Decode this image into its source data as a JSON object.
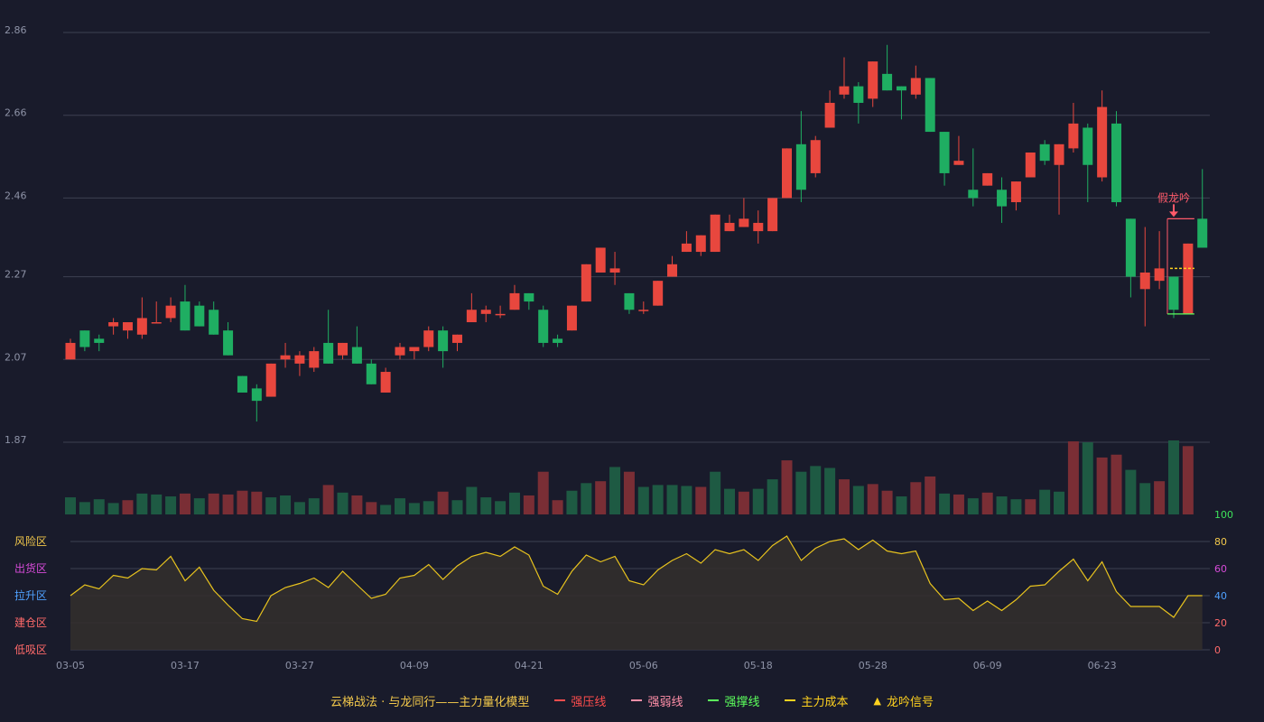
{
  "chart_data": {
    "type": "candlestick",
    "x_ticks": [
      "03-05",
      "03-17",
      "03-27",
      "04-09",
      "04-21",
      "05-06",
      "05-18",
      "05-28",
      "06-09",
      "06-23"
    ],
    "price_axis": {
      "ticks": [
        "2.86",
        "2.66",
        "2.46",
        "2.27",
        "2.07",
        "1.87"
      ],
      "ylim": [
        1.87,
        2.86
      ]
    },
    "candles": [
      {
        "o": 2.07,
        "c": 2.11,
        "h": 2.12,
        "l": 2.07
      },
      {
        "o": 2.14,
        "c": 2.1,
        "h": 2.14,
        "l": 2.09
      },
      {
        "o": 2.12,
        "c": 2.11,
        "h": 2.13,
        "l": 2.09
      },
      {
        "o": 2.15,
        "c": 2.16,
        "h": 2.17,
        "l": 2.13
      },
      {
        "o": 2.14,
        "c": 2.16,
        "h": 2.16,
        "l": 2.12
      },
      {
        "o": 2.13,
        "c": 2.17,
        "h": 2.22,
        "l": 2.12
      },
      {
        "o": 2.16,
        "c": 2.16,
        "h": 2.21,
        "l": 2.16
      },
      {
        "o": 2.17,
        "c": 2.2,
        "h": 2.22,
        "l": 2.16
      },
      {
        "o": 2.21,
        "c": 2.14,
        "h": 2.25,
        "l": 2.14
      },
      {
        "o": 2.2,
        "c": 2.15,
        "h": 2.21,
        "l": 2.15
      },
      {
        "o": 2.19,
        "c": 2.13,
        "h": 2.21,
        "l": 2.13
      },
      {
        "o": 2.14,
        "c": 2.08,
        "h": 2.16,
        "l": 2.08
      },
      {
        "o": 2.03,
        "c": 1.99,
        "h": 2.03,
        "l": 1.99
      },
      {
        "o": 2.0,
        "c": 1.97,
        "h": 2.01,
        "l": 1.92
      },
      {
        "o": 1.98,
        "c": 2.06,
        "h": 2.06,
        "l": 1.98
      },
      {
        "o": 2.07,
        "c": 2.08,
        "h": 2.11,
        "l": 2.05
      },
      {
        "o": 2.06,
        "c": 2.08,
        "h": 2.09,
        "l": 2.03
      },
      {
        "o": 2.05,
        "c": 2.09,
        "h": 2.1,
        "l": 2.04
      },
      {
        "o": 2.11,
        "c": 2.06,
        "h": 2.19,
        "l": 2.06
      },
      {
        "o": 2.08,
        "c": 2.11,
        "h": 2.11,
        "l": 2.07
      },
      {
        "o": 2.1,
        "c": 2.06,
        "h": 2.15,
        "l": 2.06
      },
      {
        "o": 2.06,
        "c": 2.01,
        "h": 2.07,
        "l": 2.01
      },
      {
        "o": 1.99,
        "c": 2.04,
        "h": 2.05,
        "l": 1.99
      },
      {
        "o": 2.08,
        "c": 2.1,
        "h": 2.11,
        "l": 2.07
      },
      {
        "o": 2.09,
        "c": 2.1,
        "h": 2.1,
        "l": 2.07
      },
      {
        "o": 2.1,
        "c": 2.14,
        "h": 2.15,
        "l": 2.09
      },
      {
        "o": 2.14,
        "c": 2.09,
        "h": 2.15,
        "l": 2.05
      },
      {
        "o": 2.11,
        "c": 2.13,
        "h": 2.13,
        "l": 2.09
      },
      {
        "o": 2.16,
        "c": 2.19,
        "h": 2.23,
        "l": 2.16
      },
      {
        "o": 2.18,
        "c": 2.19,
        "h": 2.2,
        "l": 2.16
      },
      {
        "o": 2.18,
        "c": 2.18,
        "h": 2.2,
        "l": 2.17
      },
      {
        "o": 2.19,
        "c": 2.23,
        "h": 2.25,
        "l": 2.19
      },
      {
        "o": 2.23,
        "c": 2.21,
        "h": 2.23,
        "l": 2.19
      },
      {
        "o": 2.19,
        "c": 2.11,
        "h": 2.2,
        "l": 2.1
      },
      {
        "o": 2.12,
        "c": 2.11,
        "h": 2.13,
        "l": 2.1
      },
      {
        "o": 2.14,
        "c": 2.2,
        "h": 2.2,
        "l": 2.14
      },
      {
        "o": 2.21,
        "c": 2.3,
        "h": 2.3,
        "l": 2.21
      },
      {
        "o": 2.28,
        "c": 2.34,
        "h": 2.34,
        "l": 2.28
      },
      {
        "o": 2.28,
        "c": 2.29,
        "h": 2.33,
        "l": 2.25
      },
      {
        "o": 2.23,
        "c": 2.19,
        "h": 2.23,
        "l": 2.18
      },
      {
        "o": 2.19,
        "c": 2.19,
        "h": 2.21,
        "l": 2.18
      },
      {
        "o": 2.2,
        "c": 2.26,
        "h": 2.26,
        "l": 2.2
      },
      {
        "o": 2.27,
        "c": 2.3,
        "h": 2.32,
        "l": 2.27
      },
      {
        "o": 2.33,
        "c": 2.35,
        "h": 2.38,
        "l": 2.33
      },
      {
        "o": 2.33,
        "c": 2.37,
        "h": 2.37,
        "l": 2.32
      },
      {
        "o": 2.33,
        "c": 2.42,
        "h": 2.42,
        "l": 2.33
      },
      {
        "o": 2.38,
        "c": 2.4,
        "h": 2.42,
        "l": 2.38
      },
      {
        "o": 2.39,
        "c": 2.41,
        "h": 2.46,
        "l": 2.39
      },
      {
        "o": 2.38,
        "c": 2.4,
        "h": 2.43,
        "l": 2.35
      },
      {
        "o": 2.38,
        "c": 2.46,
        "h": 2.46,
        "l": 2.38
      },
      {
        "o": 2.46,
        "c": 2.58,
        "h": 2.58,
        "l": 2.46
      },
      {
        "o": 2.59,
        "c": 2.48,
        "h": 2.67,
        "l": 2.45
      },
      {
        "o": 2.52,
        "c": 2.6,
        "h": 2.61,
        "l": 2.51
      },
      {
        "o": 2.63,
        "c": 2.69,
        "h": 2.72,
        "l": 2.63
      },
      {
        "o": 2.71,
        "c": 2.73,
        "h": 2.8,
        "l": 2.7
      },
      {
        "o": 2.73,
        "c": 2.69,
        "h": 2.74,
        "l": 2.64
      },
      {
        "o": 2.7,
        "c": 2.79,
        "h": 2.79,
        "l": 2.68
      },
      {
        "o": 2.76,
        "c": 2.72,
        "h": 2.83,
        "l": 2.72
      },
      {
        "o": 2.73,
        "c": 2.72,
        "h": 2.73,
        "l": 2.65
      },
      {
        "o": 2.71,
        "c": 2.75,
        "h": 2.78,
        "l": 2.7
      },
      {
        "o": 2.75,
        "c": 2.62,
        "h": 2.75,
        "l": 2.62
      },
      {
        "o": 2.62,
        "c": 2.52,
        "h": 2.62,
        "l": 2.49
      },
      {
        "o": 2.54,
        "c": 2.55,
        "h": 2.61,
        "l": 2.54
      },
      {
        "o": 2.48,
        "c": 2.46,
        "h": 2.58,
        "l": 2.44
      },
      {
        "o": 2.49,
        "c": 2.52,
        "h": 2.52,
        "l": 2.49
      },
      {
        "o": 2.48,
        "c": 2.44,
        "h": 2.51,
        "l": 2.4
      },
      {
        "o": 2.45,
        "c": 2.5,
        "h": 2.5,
        "l": 2.43
      },
      {
        "o": 2.51,
        "c": 2.57,
        "h": 2.57,
        "l": 2.51
      },
      {
        "o": 2.59,
        "c": 2.55,
        "h": 2.6,
        "l": 2.54
      },
      {
        "o": 2.54,
        "c": 2.59,
        "h": 2.59,
        "l": 2.42
      },
      {
        "o": 2.58,
        "c": 2.64,
        "h": 2.69,
        "l": 2.57
      },
      {
        "o": 2.63,
        "c": 2.54,
        "h": 2.64,
        "l": 2.45
      },
      {
        "o": 2.51,
        "c": 2.68,
        "h": 2.72,
        "l": 2.5
      },
      {
        "o": 2.64,
        "c": 2.45,
        "h": 2.67,
        "l": 2.44
      },
      {
        "o": 2.41,
        "c": 2.27,
        "h": 2.41,
        "l": 2.22
      },
      {
        "o": 2.24,
        "c": 2.28,
        "h": 2.39,
        "l": 2.15
      },
      {
        "o": 2.26,
        "c": 2.29,
        "h": 2.38,
        "l": 2.24
      },
      {
        "o": 2.27,
        "c": 2.19,
        "h": 2.27,
        "l": 2.17
      },
      {
        "o": 2.18,
        "c": 2.35,
        "h": 2.35,
        "l": 2.18
      },
      {
        "o": 2.41,
        "c": 2.34,
        "h": 2.53,
        "l": 2.34
      }
    ],
    "volume": [
      {
        "v": 18,
        "up": false
      },
      {
        "v": 13,
        "up": false
      },
      {
        "v": 16,
        "up": false
      },
      {
        "v": 12,
        "up": false
      },
      {
        "v": 15,
        "up": true
      },
      {
        "v": 22,
        "up": false
      },
      {
        "v": 21,
        "up": false
      },
      {
        "v": 19,
        "up": false
      },
      {
        "v": 22,
        "up": true
      },
      {
        "v": 17,
        "up": false
      },
      {
        "v": 22,
        "up": true
      },
      {
        "v": 21,
        "up": true
      },
      {
        "v": 25,
        "up": true
      },
      {
        "v": 24,
        "up": true
      },
      {
        "v": 18,
        "up": false
      },
      {
        "v": 20,
        "up": false
      },
      {
        "v": 13,
        "up": false
      },
      {
        "v": 17,
        "up": false
      },
      {
        "v": 31,
        "up": true
      },
      {
        "v": 23,
        "up": false
      },
      {
        "v": 20,
        "up": true
      },
      {
        "v": 13,
        "up": true
      },
      {
        "v": 10,
        "up": false
      },
      {
        "v": 17,
        "up": false
      },
      {
        "v": 12,
        "up": false
      },
      {
        "v": 14,
        "up": false
      },
      {
        "v": 24,
        "up": true
      },
      {
        "v": 15,
        "up": false
      },
      {
        "v": 29,
        "up": false
      },
      {
        "v": 18,
        "up": false
      },
      {
        "v": 14,
        "up": false
      },
      {
        "v": 23,
        "up": false
      },
      {
        "v": 20,
        "up": true
      },
      {
        "v": 45,
        "up": true
      },
      {
        "v": 15,
        "up": true
      },
      {
        "v": 25,
        "up": false
      },
      {
        "v": 33,
        "up": false
      },
      {
        "v": 35,
        "up": true
      },
      {
        "v": 50,
        "up": false
      },
      {
        "v": 45,
        "up": true
      },
      {
        "v": 29,
        "up": false
      },
      {
        "v": 31,
        "up": false
      },
      {
        "v": 31,
        "up": false
      },
      {
        "v": 30,
        "up": false
      },
      {
        "v": 29,
        "up": true
      },
      {
        "v": 45,
        "up": false
      },
      {
        "v": 27,
        "up": false
      },
      {
        "v": 24,
        "up": true
      },
      {
        "v": 27,
        "up": false
      },
      {
        "v": 37,
        "up": false
      },
      {
        "v": 57,
        "up": true
      },
      {
        "v": 45,
        "up": false
      },
      {
        "v": 51,
        "up": false
      },
      {
        "v": 49,
        "up": false
      },
      {
        "v": 37,
        "up": true
      },
      {
        "v": 30,
        "up": false
      },
      {
        "v": 32,
        "up": true
      },
      {
        "v": 25,
        "up": true
      },
      {
        "v": 19,
        "up": false
      },
      {
        "v": 34,
        "up": true
      },
      {
        "v": 40,
        "up": true
      },
      {
        "v": 22,
        "up": false
      },
      {
        "v": 21,
        "up": true
      },
      {
        "v": 17,
        "up": false
      },
      {
        "v": 23,
        "up": true
      },
      {
        "v": 19,
        "up": false
      },
      {
        "v": 16,
        "up": false
      },
      {
        "v": 16,
        "up": true
      },
      {
        "v": 26,
        "up": false
      },
      {
        "v": 24,
        "up": false
      },
      {
        "v": 77,
        "up": true
      },
      {
        "v": 76,
        "up": false
      },
      {
        "v": 60,
        "up": true
      },
      {
        "v": 63,
        "up": true
      },
      {
        "v": 47,
        "up": false
      },
      {
        "v": 33,
        "up": false
      },
      {
        "v": 35,
        "up": true
      },
      {
        "v": 78,
        "up": false
      },
      {
        "v": 72,
        "up": true
      }
    ],
    "signal": {
      "text": "假龙吟",
      "box": {
        "from_index": 77,
        "to_index": 78,
        "high": 2.41,
        "low": 2.18
      },
      "cost": 2.29
    },
    "zone_labels": [
      "风险区",
      "出货区",
      "拉升区",
      "建仓区",
      "低吸区"
    ],
    "zone_colors": [
      "#f2c84b",
      "#d64bd8",
      "#4fa1ff",
      "#ff6a6a",
      "#ff6a6a"
    ],
    "osc_axis": {
      "ticks": [
        "100",
        "80",
        "60",
        "40",
        "20",
        "0"
      ],
      "ylim": [
        0,
        100
      ]
    },
    "osc_tick_colors": [
      "#3de25a",
      "#f2c84b",
      "#d64bd8",
      "#4fa1ff",
      "#ff6a6a",
      "#ff6a6a"
    ],
    "oscillator": [
      40,
      48,
      45,
      55,
      53,
      60,
      59,
      69,
      51,
      61,
      44,
      33,
      23,
      21,
      40,
      46,
      49,
      53,
      46,
      58,
      48,
      38,
      41,
      53,
      55,
      63,
      52,
      62,
      69,
      72,
      69,
      76,
      70,
      47,
      41,
      58,
      70,
      65,
      69,
      51,
      48,
      59,
      66,
      71,
      64,
      74,
      71,
      74,
      66,
      77,
      84,
      66,
      75,
      80,
      82,
      74,
      81,
      73,
      71,
      73,
      49,
      37,
      38,
      29,
      36,
      29,
      37,
      47,
      48,
      58,
      67,
      51,
      65,
      43,
      32,
      32,
      32,
      24,
      40,
      40
    ],
    "legend": {
      "title": "云梯战法 · 与龙同行——主力量化模型",
      "items": [
        {
          "label": "强压线",
          "color": "#ff4d4d",
          "style": "solid"
        },
        {
          "label": "强弱线",
          "color": "#ff8fa8",
          "style": "dashed"
        },
        {
          "label": "强撑线",
          "color": "#5cff5c",
          "style": "solid"
        },
        {
          "label": "主力成本",
          "color": "#ffd21f",
          "style": "dashed"
        },
        {
          "label": "龙吟信号",
          "color": "#ffd21f",
          "style": "triangle"
        }
      ]
    },
    "colors": {
      "up": "#e8473e",
      "down": "#1fae62",
      "up_vol": "#7a2e35",
      "down_vol": "#1e5a43",
      "grid": "#3d4052",
      "axis_text": "#8e93a7",
      "osc_line": "#e8c31e",
      "osc_fill": "#342f2d",
      "signal": "#ff5a6a"
    }
  }
}
